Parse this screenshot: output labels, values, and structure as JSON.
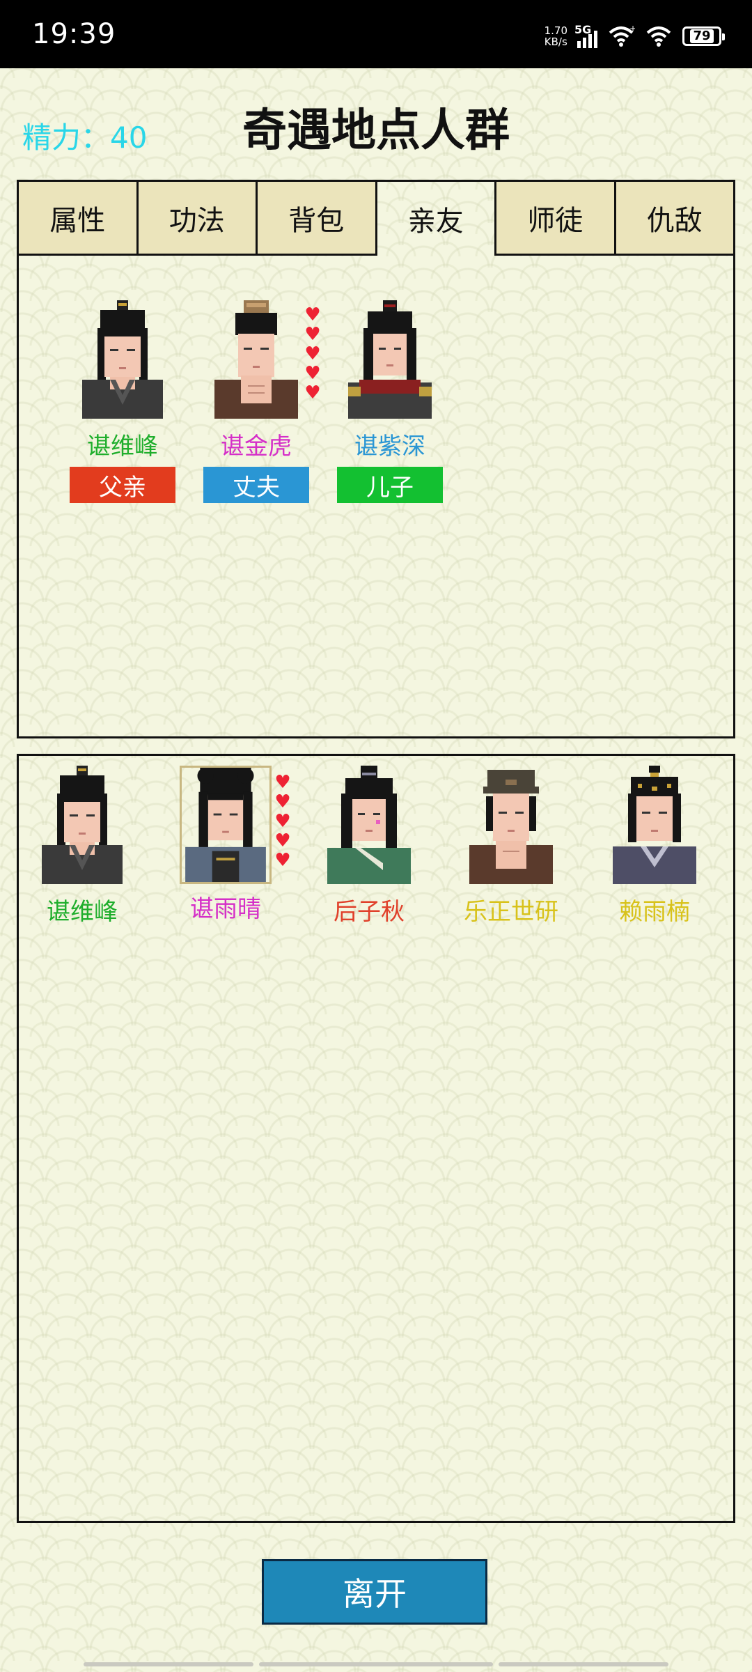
{
  "status_bar": {
    "time": "19:39",
    "net_speed_value": "1.70",
    "net_speed_unit": "KB/s",
    "network": "5G",
    "battery": "79"
  },
  "header": {
    "energy_label": "精力：40",
    "title": "奇遇地点人群"
  },
  "tabs": [
    {
      "label": "属性",
      "active": false
    },
    {
      "label": "功法",
      "active": false
    },
    {
      "label": "背包",
      "active": false
    },
    {
      "label": "亲友",
      "active": true
    },
    {
      "label": "师徒",
      "active": false
    },
    {
      "label": "仇敌",
      "active": false
    }
  ],
  "relatives": [
    {
      "name": "谌维峰",
      "name_color": "#1fae2c",
      "relation": "父亲",
      "badge_color": "#e23c1e",
      "hearts": 0
    },
    {
      "name": "谌金虎",
      "name_color": "#d52fc8",
      "relation": "丈夫",
      "badge_color": "#2a96d4",
      "hearts": 5
    },
    {
      "name": "谌紫深",
      "name_color": "#2a96d4",
      "relation": "儿子",
      "badge_color": "#13c031",
      "hearts": 0
    }
  ],
  "people": [
    {
      "name": "谌维峰",
      "name_color": "#1fae2c",
      "hearts": 0,
      "selected": false
    },
    {
      "name": "谌雨晴",
      "name_color": "#d52fc8",
      "hearts": 5,
      "selected": true
    },
    {
      "name": "后子秋",
      "name_color": "#e0402a",
      "hearts": 0,
      "selected": false
    },
    {
      "name": "乐正世研",
      "name_color": "#d8c21a",
      "hearts": 0,
      "selected": false
    },
    {
      "name": "赖雨楠",
      "name_color": "#d8c21a",
      "hearts": 0,
      "selected": false
    }
  ],
  "footer": {
    "leave_label": "离开"
  }
}
